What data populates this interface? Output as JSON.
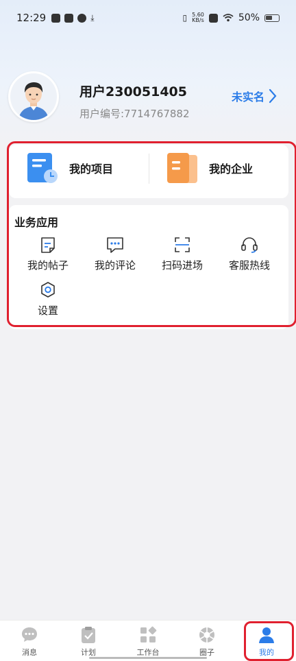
{
  "status_bar": {
    "time": "12:29",
    "speed_value": "5.60",
    "speed_unit": "KB/s",
    "battery": "50%"
  },
  "profile": {
    "username": "用户230051405",
    "user_id": "用户编号:7714767882",
    "verify_label": "未实名"
  },
  "quick_access": [
    {
      "label": "我的项目",
      "icon": "project-doc-icon",
      "color": "#3b8ff0"
    },
    {
      "label": "我的企业",
      "icon": "company-doc-icon",
      "color": "#f59a4a"
    }
  ],
  "business_apps": {
    "title": "业务应用",
    "items": [
      {
        "label": "我的帖子",
        "icon": "post-icon"
      },
      {
        "label": "我的评论",
        "icon": "comment-icon"
      },
      {
        "label": "扫码进场",
        "icon": "scan-icon"
      },
      {
        "label": "客服热线",
        "icon": "headset-icon"
      },
      {
        "label": "设置",
        "icon": "settings-icon"
      }
    ]
  },
  "tab_bar": {
    "active": "我的",
    "items": [
      {
        "label": "消息",
        "icon": "message-icon"
      },
      {
        "label": "计划",
        "icon": "plan-icon"
      },
      {
        "label": "工作台",
        "icon": "workbench-icon"
      },
      {
        "label": "圈子",
        "icon": "circle-icon"
      },
      {
        "label": "我的",
        "icon": "person-icon"
      }
    ]
  },
  "colors": {
    "accent": "#2b7ce8",
    "highlight": "#e0202f"
  }
}
